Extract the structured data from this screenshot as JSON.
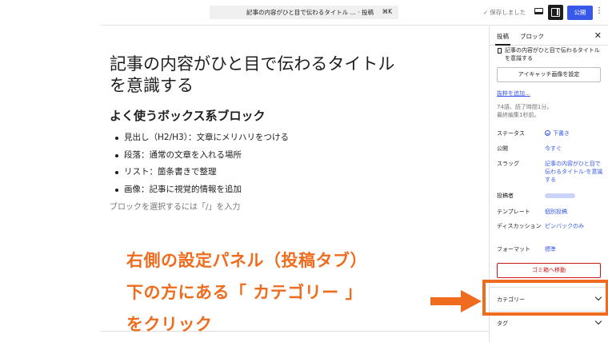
{
  "header": {
    "doc_title": "記事の内容がひと目で伝わるタイトル ... · 投稿",
    "shortcut": "⌘K",
    "saved_label": "保存しました",
    "saved_icon": "check-icon",
    "view_icon": "desktop-view-icon",
    "settings_icon": "sidebar-toggle-icon",
    "publish_label": "公開",
    "more_icon": "vertical-ellipsis-icon",
    "accent_color": "#3858e9"
  },
  "editor": {
    "post_title": "記事の内容がひと目で伝わるタイトル を意識する",
    "heading": "よく使うボックス系ブロック",
    "list_items": [
      "見出し（H2/H3）：文章にメリハリをつける",
      "段落：通常の文章を入れる場所",
      "リスト：箇条書きで整理",
      "画像：記事に視覚的情報を追加"
    ],
    "placeholder": "ブロックを選択するには「/」を入力"
  },
  "annotation": {
    "lines": [
      "右側の設定パネル（投稿タブ）",
      "下の方にある「 カテゴリー 」",
      "をクリック"
    ],
    "color": "#ef6c1f"
  },
  "sidebar": {
    "tabs": [
      "投稿",
      "ブロック"
    ],
    "active_tab": "投稿",
    "close_icon": "close-icon",
    "excerpt_text": "記事の内容がひと目で伝わるタイトル を意識する",
    "featured_image_button": "アイキャッチ画像を設定",
    "add_excerpt_link": "抜粋を追加...",
    "stats": "74語、読了時間1分。",
    "last_edited": "最終編集1秒前。",
    "rows": [
      {
        "label": "ステータス",
        "value": "下書き"
      },
      {
        "label": "公開",
        "value": "今すぐ"
      },
      {
        "label": "スラッグ",
        "value": "記事の内容がひと目で伝わるタイトル-を意識する"
      },
      {
        "label": "投稿者",
        "value": ""
      },
      {
        "label": "テンプレート",
        "value": "個別投稿"
      },
      {
        "label": "ディスカッション",
        "value": "ピンバックのみ"
      },
      {
        "label": "フォーマット",
        "value": "標準"
      }
    ],
    "trash_button": "ゴミ箱へ移動",
    "sections": [
      {
        "label": "カテゴリー",
        "icon": "chevron-down-icon"
      },
      {
        "label": "タグ",
        "icon": "chevron-down-icon"
      }
    ]
  }
}
